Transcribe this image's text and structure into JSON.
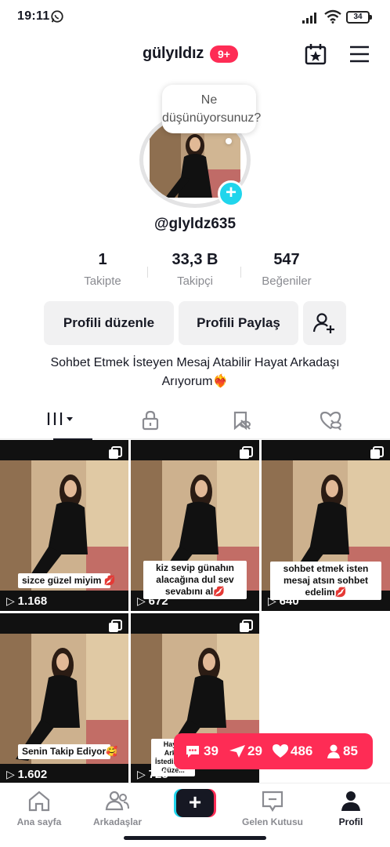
{
  "status_bar": {
    "time": "19:11",
    "battery": "34"
  },
  "header": {
    "username": "gülyıldız",
    "notification_count": "9+"
  },
  "avatar": {
    "thought_bubble": "Ne düşünüyorsunuz?",
    "handle": "@glyldz635"
  },
  "stats": [
    {
      "value": "1",
      "label": "Takipte"
    },
    {
      "value": "33,3 B",
      "label": "Takipçi"
    },
    {
      "value": "547",
      "label": "Beğeniler"
    }
  ],
  "actions": {
    "edit_profile": "Profili düzenle",
    "share_profile": "Profili Paylaş"
  },
  "bio": "Sohbet Etmek İsteyen Mesaj Atabilir Hayat Arkadaşı Arıyorum❤️‍🔥",
  "tabs": [
    "videos-grid",
    "private",
    "reposts",
    "liked"
  ],
  "videos": [
    {
      "caption": "sizce güzel miyim 💋",
      "views": "1.168"
    },
    {
      "caption": "kiz sevip günahın alacağına dul sev sevabını al💋",
      "views": "672"
    },
    {
      "caption": "sohbet etmek isten mesaj atsın sohbet edelim💋",
      "views": "640"
    },
    {
      "caption": "Senin Takip Ediyor🥰",
      "views": "1.602"
    },
    {
      "caption": "Hayat Ark... İstedikler... Güze...",
      "views": "728"
    }
  ],
  "live_stats": {
    "comments": "39",
    "shares": "29",
    "likes": "486",
    "followers": "85"
  },
  "bottom_nav": {
    "home": "Ana sayfa",
    "friends": "Arkadaşlar",
    "inbox": "Gelen Kutusu",
    "profile": "Profil"
  },
  "colors": {
    "accent_pink": "#fe2c55",
    "accent_cyan": "#20d5ec",
    "text_primary": "#161823",
    "text_secondary": "#8a8b91"
  }
}
